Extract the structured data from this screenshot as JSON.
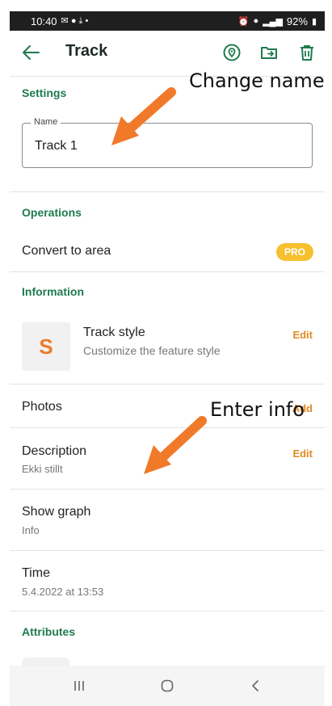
{
  "status_bar": {
    "time": "10:40",
    "battery": "92%"
  },
  "app_bar": {
    "title": "Track"
  },
  "settings": {
    "header": "Settings",
    "name_label": "Name",
    "name_value": "Track 1"
  },
  "operations": {
    "header": "Operations",
    "convert_label": "Convert to area",
    "pro_badge": "PRO"
  },
  "information": {
    "header": "Information",
    "style_icon_letter": "S",
    "style_title": "Track style",
    "style_subtitle": "Customize the feature style",
    "style_edit": "Edit",
    "photos_label": "Photos",
    "photos_action": "Add",
    "description_label": "Description",
    "description_value": "Ekki stillt",
    "description_edit": "Edit",
    "graph_label": "Show graph",
    "graph_value": "Info",
    "time_label": "Time",
    "time_value": "5.4.2022 at 13:53"
  },
  "attributes": {
    "header": "Attributes"
  },
  "annotations": {
    "change_name": "Change name",
    "enter_info": "Enter info"
  },
  "colors": {
    "accent_green": "#1e7a4f",
    "edit_orange": "#e08a1e",
    "pro_yellow": "#f6c02e",
    "arrow_orange": "#f07a2a"
  },
  "icons": {
    "back": "arrow-left-icon",
    "map_pin": "map-pin-circle-icon",
    "folder_move": "folder-move-icon",
    "delete": "trash-icon"
  }
}
